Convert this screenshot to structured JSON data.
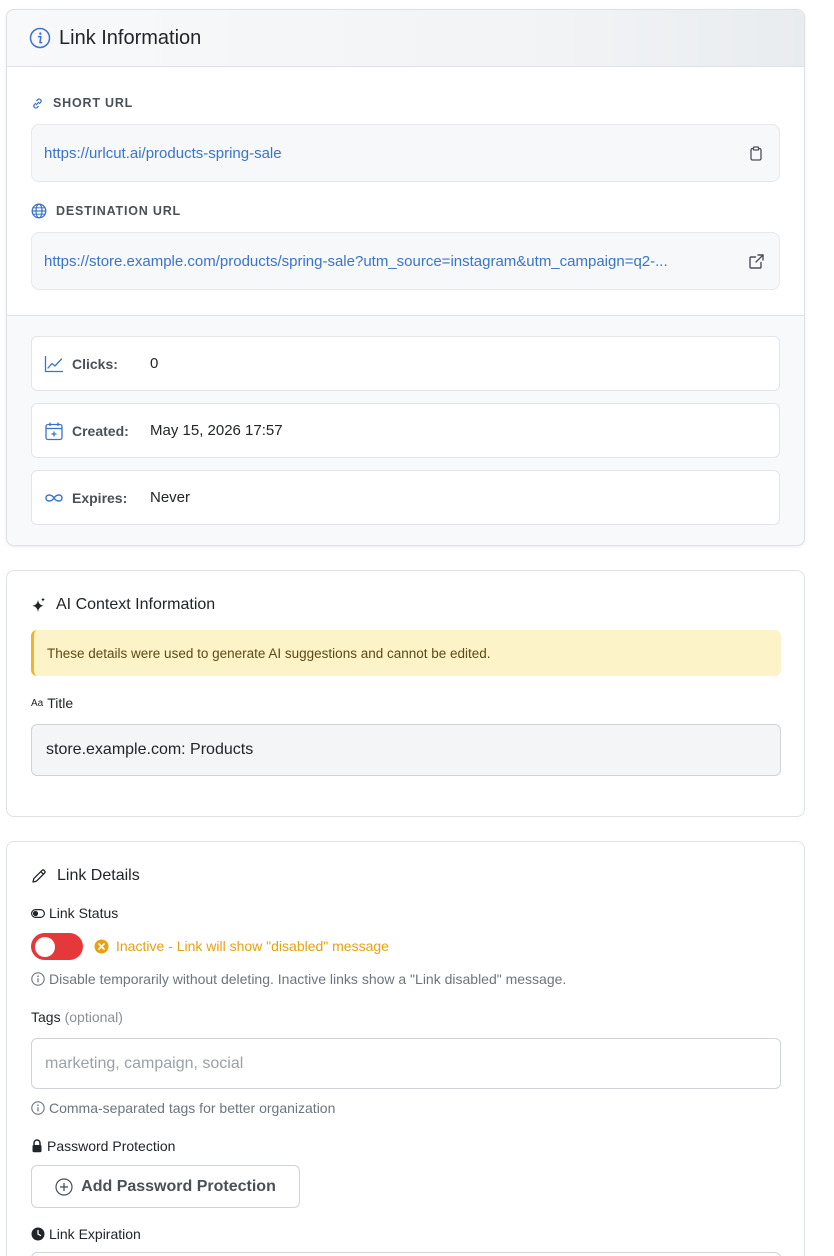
{
  "link_info": {
    "header_title": "Link Information",
    "short_url_label": "SHORT URL",
    "short_url": "https://urlcut.ai/products-spring-sale",
    "destination_url_label": "DESTINATION URL",
    "destination_url": "https://store.example.com/products/spring-sale?utm_source=instagram&utm_campaign=q2-...",
    "stats": [
      {
        "label": "Clicks:",
        "value": "0",
        "icon": "chart-line-icon"
      },
      {
        "label": "Created:",
        "value": "May 15, 2026 17:57",
        "icon": "calendar-plus-icon"
      },
      {
        "label": "Expires:",
        "value": "Never",
        "icon": "infinity-icon"
      }
    ]
  },
  "ai_context": {
    "title": "AI Context Information",
    "notice": "These details were used to generate AI suggestions and cannot be edited.",
    "title_field_label": "Title",
    "title_field_value": "store.example.com: Products"
  },
  "link_details": {
    "title": "Link Details",
    "status_label": "Link Status",
    "status_message": "Inactive - Link will show \"disabled\" message",
    "status_hint": "Disable temporarily without deleting. Inactive links show a \"Link disabled\" message.",
    "tags_label": "Tags",
    "tags_optional": "(optional)",
    "tags_placeholder": "marketing, campaign, social",
    "tags_hint": "Comma-separated tags for better organization",
    "password_label": "Password Protection",
    "add_password_button": "Add Password Protection",
    "expiration_label": "Link Expiration"
  },
  "colors": {
    "accent_blue": "#3a74c9",
    "toggle_off_red": "#e5383b",
    "warning_amber": "#e8a10f",
    "notice_bg": "#fdf3c8"
  }
}
